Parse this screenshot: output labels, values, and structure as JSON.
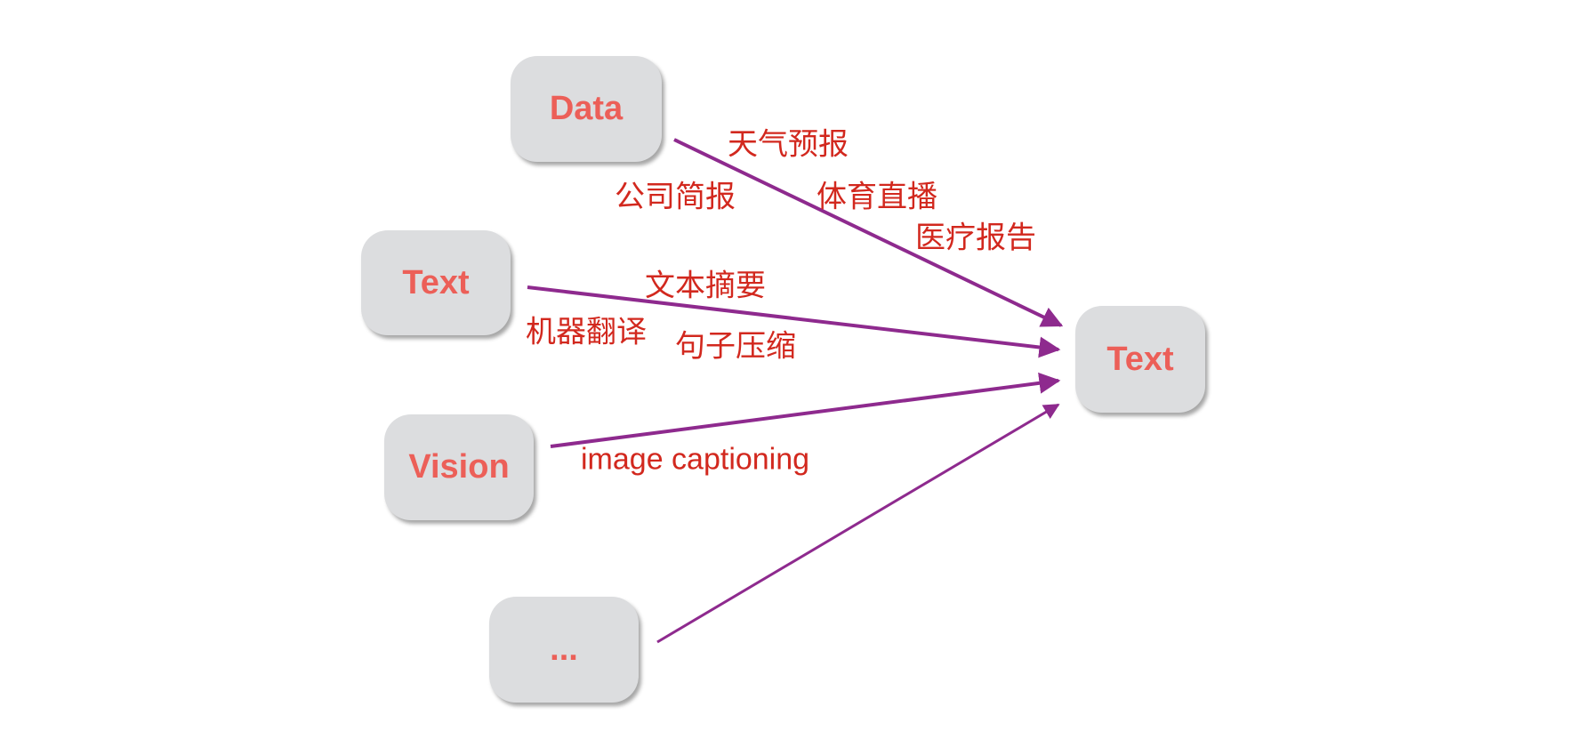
{
  "colors": {
    "box_fill": "#dcdddf",
    "box_text": "#ec5f58",
    "label_text": "#d2281e",
    "arrow": "#8e2a8e"
  },
  "sources": [
    {
      "label": "Data"
    },
    {
      "label": "Text"
    },
    {
      "label": "Vision"
    },
    {
      "label": "..."
    }
  ],
  "target": {
    "label": "Text"
  },
  "edge_labels": {
    "data": [
      "天气预报",
      "公司简报",
      "体育直播",
      "医疗报告"
    ],
    "text": [
      "文本摘要",
      "机器翻译",
      "句子压缩"
    ],
    "vision": [
      "image captioning"
    ]
  }
}
